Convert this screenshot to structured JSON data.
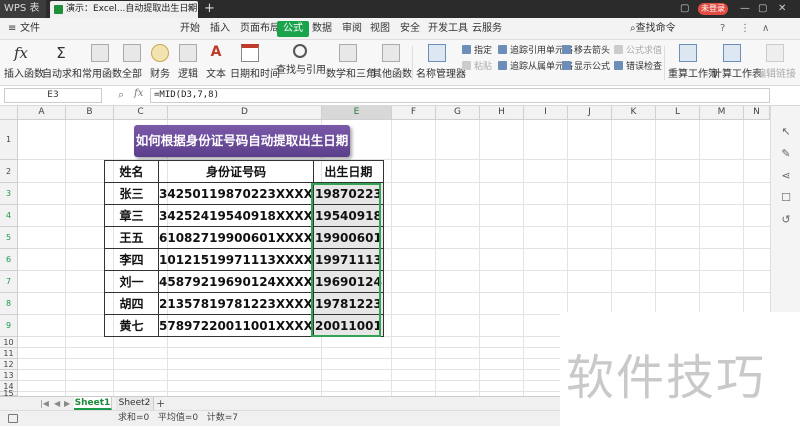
{
  "titlebar": {
    "app_tab": "WPS 表格",
    "doc_tab": "演示：Excel...自动提取出生日期",
    "login": "未登录"
  },
  "menu": {
    "file": "文件",
    "items": [
      "开始",
      "插入",
      "页面布局",
      "公式",
      "数据",
      "审阅",
      "视图",
      "安全",
      "开发工具",
      "云服务"
    ],
    "active": "公式",
    "search": "查找命令"
  },
  "toolbar": {
    "large": [
      "插入函数",
      "自动求和",
      "常用函数",
      "全部",
      "财务",
      "逻辑",
      "文本",
      "日期和时间",
      "查找与引用",
      "数学和三角",
      "其他函数",
      "名称管理器",
      "重算工作簿",
      "计算工作表"
    ],
    "small": [
      "指定",
      "粘贴",
      "追踪引用单元格",
      "追踪从属单元格",
      "移去箭头",
      "显示公式",
      "公式求值",
      "错误检查"
    ],
    "small_disabled": [
      "粘贴",
      "公式求值"
    ],
    "last": "编辑链接"
  },
  "formula_bar": {
    "cell_ref": "E3",
    "formula": "=MID(D3,7,8)"
  },
  "columns": [
    "A",
    "B",
    "C",
    "D",
    "E",
    "F",
    "G",
    "H",
    "I",
    "J",
    "K",
    "L",
    "M",
    "N"
  ],
  "selected_column": "E",
  "rows": [
    "1",
    "2",
    "3",
    "4",
    "5",
    "6",
    "7",
    "8",
    "9",
    "10",
    "11",
    "12",
    "13",
    "14",
    "15",
    "16",
    "17",
    "18",
    "19",
    "20"
  ],
  "banner": "如何根据身份证号码自动提取出生日期",
  "table": {
    "headers": [
      "姓名",
      "身份证号码",
      "出生日期"
    ],
    "rows": [
      [
        "张三",
        "34250119870223XXXX",
        "19870223"
      ],
      [
        "章三",
        "34252419540918XXXX",
        "19540918"
      ],
      [
        "王五",
        "61082719900601XXXX",
        "19900601"
      ],
      [
        "李四",
        "10121519971113XXXX",
        "19971113"
      ],
      [
        "刘一",
        "45879219690124XXXX",
        "19690124"
      ],
      [
        "胡四",
        "21357819781223XXXX",
        "19781223"
      ],
      [
        "黄七",
        "57897220011001XXXX",
        "20011001"
      ]
    ]
  },
  "sheets": [
    "Sheet1",
    "Sheet2"
  ],
  "active_sheet": "Sheet1",
  "status": "求和=0   平均值=0   计数=7",
  "watermark": "软件技巧",
  "colors": {
    "accent_green": "#19a34a",
    "banner_purple": "#6a4a9a",
    "login_red": "#e14d43"
  }
}
